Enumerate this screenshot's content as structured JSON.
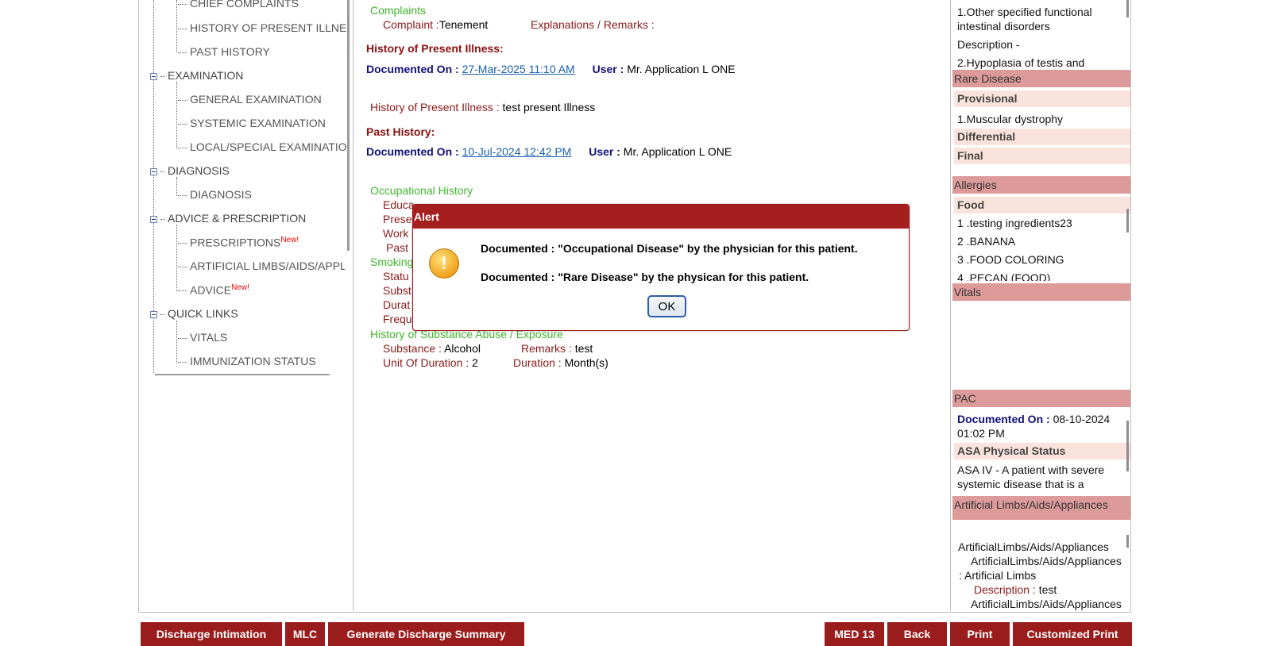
{
  "tree": {
    "items": [
      {
        "label": "CHIEF COMPLAINTS",
        "level": 1
      },
      {
        "label": "HISTORY OF PRESENT ILLNE",
        "level": 1
      },
      {
        "label": "PAST HISTORY",
        "level": 1
      },
      {
        "label": "EXAMINATION",
        "level": 0
      },
      {
        "label": "GENERAL EXAMINATION",
        "level": 1
      },
      {
        "label": "SYSTEMIC EXAMINATION",
        "level": 1
      },
      {
        "label": "LOCAL/SPECIAL EXAMINATIO",
        "level": 1
      },
      {
        "label": "DIAGNOSIS",
        "level": 0
      },
      {
        "label": "DIAGNOSIS",
        "level": 1
      },
      {
        "label": "ADVICE & PRESCRIPTION",
        "level": 0
      },
      {
        "label": "PRESCRIPTIONS",
        "level": 1,
        "badge": "New!"
      },
      {
        "label": "ARTIFICIAL LIMBS/AIDS/APPLI",
        "level": 1
      },
      {
        "label": "ADVICE",
        "level": 1,
        "badge": "New!"
      },
      {
        "label": "QUICK LINKS",
        "level": 0
      },
      {
        "label": "VITALS",
        "level": 1
      },
      {
        "label": "IMMUNIZATION STATUS",
        "level": 1
      }
    ]
  },
  "main": {
    "complaints_heading": "Complaints",
    "complaint_label": "Complaint :",
    "complaint_value": "Tenement",
    "explanations_label": "Explanations / Remarks :",
    "hpi_heading": "History of Present Illness:",
    "documented_on_label": "Documented On :",
    "hpi_date": "27-Mar-2025 11:10 AM",
    "user_label": "User :",
    "hpi_user": "Mr. Application L ONE",
    "hpi_label": "History of Present Illness :",
    "hpi_value": "test present Illness",
    "past_heading": "Past History:",
    "past_date": "10-Jul-2024 12:42 PM",
    "past_user": "Mr. Application L ONE",
    "occ_heading": "Occupational History",
    "occ_edu": "Educa",
    "occ_pres": "Prese",
    "occ_work": "Work",
    "occ_past": "Past",
    "smoking_heading": "Smoking",
    "smk_status": "Statu",
    "smk_subst": "Subst",
    "smk_dur": "Durat",
    "smk_freq": "Frequ",
    "substance_heading": "History of Substance Abuse / Exposure",
    "substance_label": "Substance :",
    "substance_value": "Alcohol",
    "remarks_label": "Remarks :",
    "remarks_value": "test",
    "unit_label": "Unit Of Duration :",
    "unit_value": "2",
    "duration_label": "Duration :",
    "duration_value": "Month(s)"
  },
  "right": {
    "diag_line1": "1.Other specified functional intestinal disorders",
    "diag_desc": "Description -",
    "diag_line2": "2.Hypoplasia of testis and",
    "rare_heading": "Rare Disease",
    "provisional": "Provisional",
    "rare_item": "1.Muscular dystrophy",
    "differential": "Differential",
    "final": "Final",
    "allergies_heading": "Allergies",
    "food": "Food",
    "allergy_items": [
      "1 .testing ingredients23",
      "2 .BANANA",
      "3 .FOOD COLORING",
      "4 .PECAN (FOOD)"
    ],
    "vitals_heading": "Vitals",
    "pac_heading": "PAC",
    "pac_documented_label": "Documented On :",
    "pac_date": "08-10-2024 01:02 PM",
    "asa_heading": "ASA Physical Status",
    "asa_text": "ASA IV - A patient with severe systemic disease that is a",
    "limbs_heading": "Artificial Limbs/Aids/Appliances",
    "limbs_green": "ArtificialLimbs/Aids/Appliances",
    "limbs_maroon": "ArtificialLimbs/Aids/Appliances",
    "limbs_value": ": Artificial Limbs",
    "limbs_desc_label": "Description :",
    "limbs_desc_value": "test",
    "limbs_more": "ArtificialLimbs/Aids/Appliances"
  },
  "buttons": {
    "discharge_intimation": "Discharge Intimation",
    "mlc": "MLC",
    "generate_summary": "Generate Discharge Summary",
    "med13": "MED 13",
    "back": "Back",
    "print": "Print",
    "customized_print": "Customized Print"
  },
  "alert": {
    "title": "Alert",
    "line1": "Documented : \"Occupational Disease\" by the physician for this patient.",
    "line2": "Documented : \"Rare Disease\" by the physican for this patient.",
    "ok": "OK",
    "icon": "warning-icon"
  }
}
